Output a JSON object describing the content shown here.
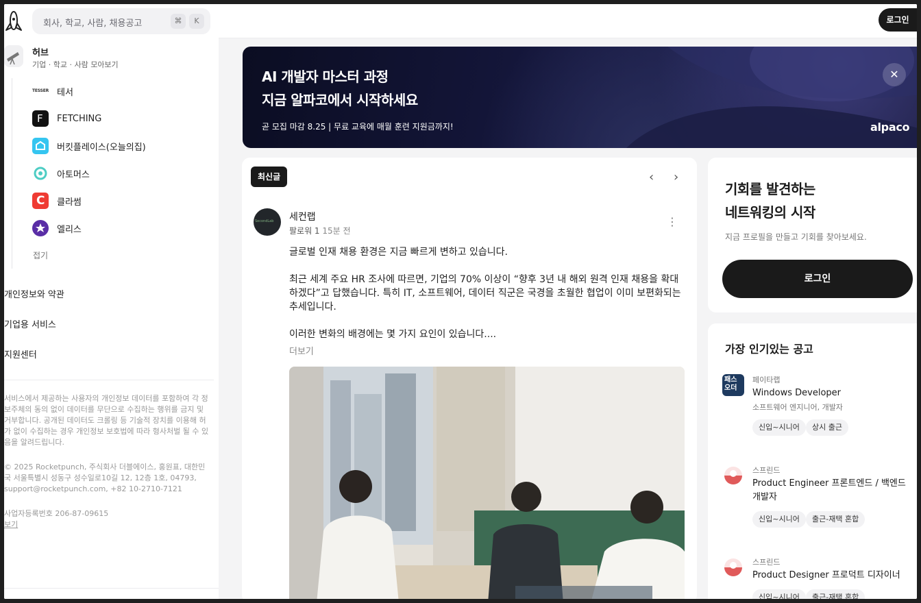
{
  "search": {
    "placeholder": "회사, 학교, 사람, 채용공고",
    "kbd1": "⌘",
    "kbd2": "K"
  },
  "topbar": {
    "login_label": "로그인"
  },
  "sidebar": {
    "hub": {
      "title": "허브",
      "subtitle": "기업 · 학교 · 사람 모아보기"
    },
    "companies": [
      {
        "label": "테서",
        "icon": "tesser-logo",
        "logo_text": "TESSER"
      },
      {
        "label": "FETCHING",
        "icon": "fetching-logo",
        "logo_text": "F"
      },
      {
        "label": "버킷플레이스(오늘의집)",
        "icon": "bucketplace-logo"
      },
      {
        "label": "아토머스",
        "icon": "atomus-logo"
      },
      {
        "label": "클라썸",
        "icon": "classum-logo",
        "logo_text": "C"
      },
      {
        "label": "엘리스",
        "icon": "elice-logo"
      }
    ],
    "fold_label": "접기",
    "links": [
      "개인정보와 약관",
      "기업용 서비스",
      "지원센터"
    ],
    "notice": "서비스에서 제공하는 사용자의 개인정보 데이터를 포함하여 각 정보주체의 동의 없이 데이터를 무단으로 수집하는 행위를 금지 및 거부합니다. 공개된 데이터도 크롤링 등 기술적 장치를 이용해 허가 없이 수집하는 경우 개인정보 보호법에 따라 형사처벌 될 수 있음을 알려드립니다.",
    "company_info": "© 2025 Rocketpunch, 주식회사 더블에이스, 홍원표, 대한민국 서울특별시 성동구 성수일로10길 12, 12층 1호, 04793, support@rocketpunch.com, +82 10-2710-7121",
    "biz_no": "사업자등록번호 206-87-09615",
    "biz_link": "보기"
  },
  "banner": {
    "title_line1": "AI 개발자 마스터 과정",
    "title_line2": "지금 알파코에서 시작하세요",
    "subtitle": "곧 모집 마감 8.25  |  무료 교육에 매월 훈련 지원금까지!",
    "brand": "alpaco",
    "close_icon": "close-icon"
  },
  "feed": {
    "tab_label": "최신글",
    "post": {
      "author": "세컨랩",
      "avatar_text": "SecondLab",
      "followers": "팔로워 1",
      "time": "15분 전",
      "para1": "글로벌 인재 채용 환경은 지금 빠르게 변하고 있습니다.",
      "para2": "최근 세계 주요 HR 조사에 따르면, 기업의 70% 이상이 “향후 3년 내 해외 원격 인재 채용을 확대하겠다”고 답했습니다. 특히 IT, 소프트웨어, 데이터 직군은 국경을 초월한 협업이 이미 보편화되는 추세입니다.",
      "para3": "이러한 변화의 배경에는 몇 가지 요인이 있습니다....",
      "read_more": "더보기"
    }
  },
  "network_card": {
    "title_line1": "기회를 발견하는",
    "title_line2": "네트워킹의 시작",
    "subtitle": "지금 프로필을 만들고 기회를 찾아보세요.",
    "button": "로그인"
  },
  "popular_jobs": {
    "title": "가장 인기있는 공고",
    "jobs": [
      {
        "company": "페이타랩",
        "title": "Windows Developer",
        "category": "소프트웨어 엔지니어, 개발자",
        "tags": [
          "신입~시니어",
          "상시 출근"
        ],
        "logo_text": "패스오더"
      },
      {
        "company": "스프린드",
        "title": "Product Engineer 프론트엔드 / 백엔드 개발자",
        "category": "",
        "tags": [
          "신입~시니어",
          "출근-재택 혼합"
        ]
      },
      {
        "company": "스프린드",
        "title": "Product Designer 프로덕트 디자이너",
        "category": "",
        "tags": [
          "신입~시니어",
          "출근-재택 혼합"
        ]
      }
    ]
  },
  "colors": {
    "dark": "#1a1a1a",
    "background": "#f4f4f5"
  }
}
